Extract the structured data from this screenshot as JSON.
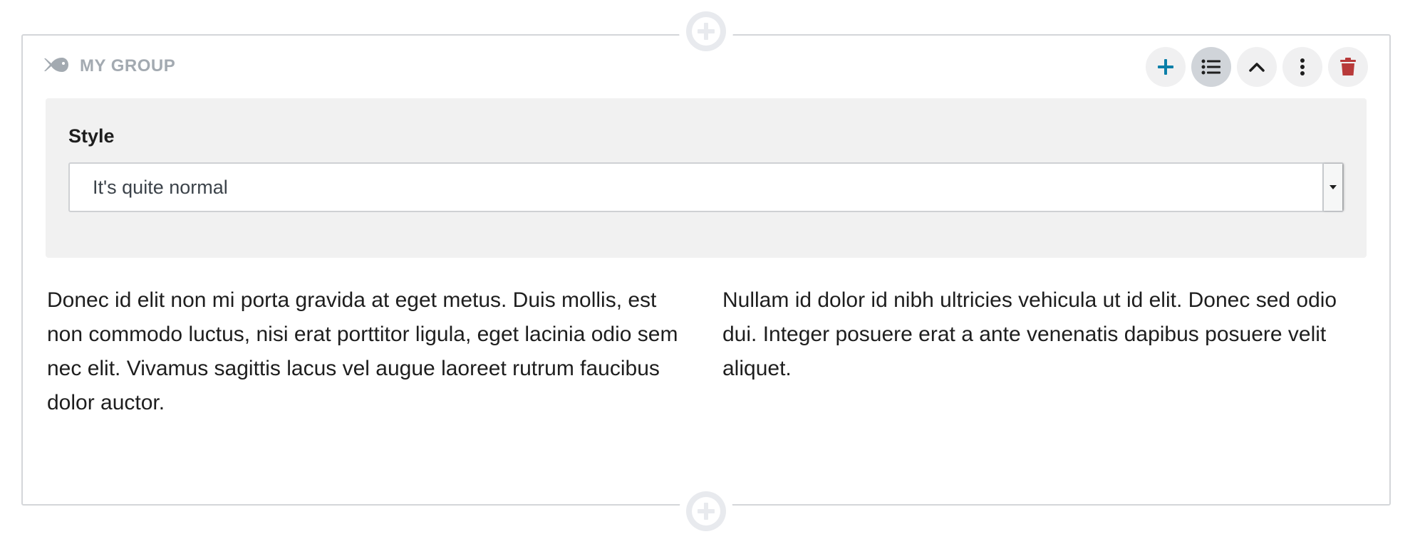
{
  "group": {
    "icon": "fish-icon",
    "label": "MY GROUP"
  },
  "toolbar": {
    "buttons": [
      {
        "name": "add",
        "icon": "plus-icon",
        "color": "#0a7fa8"
      },
      {
        "name": "list-view",
        "icon": "list-icon",
        "active": true
      },
      {
        "name": "collapse",
        "icon": "chevron-up-icon"
      },
      {
        "name": "more-options",
        "icon": "vertical-ellipsis-icon"
      },
      {
        "name": "delete",
        "icon": "trash-icon",
        "color": "#b83a3a"
      }
    ]
  },
  "settings": {
    "style_label": "Style",
    "style_value": "It's quite normal"
  },
  "content": {
    "column_left": "Donec id elit non mi porta gravida at eget metus. Duis mollis, est non commodo luctus, nisi erat porttitor ligula, eget lacinia odio sem nec elit. Vivamus sagittis lacus vel augue laoreet rutrum faucibus dolor auctor.",
    "column_right": "Nullam id dolor id nibh ultricies vehicula ut id elit. Donec sed odio dui. Integer posuere erat a ante venenatis dapibus posuere velit aliquet."
  },
  "colors": {
    "border": "#d4d6d9",
    "muted_label": "#a3aab1",
    "settings_background": "#f1f1f1",
    "add_accent": "#0a7fa8",
    "delete_accent": "#b83a3a"
  }
}
